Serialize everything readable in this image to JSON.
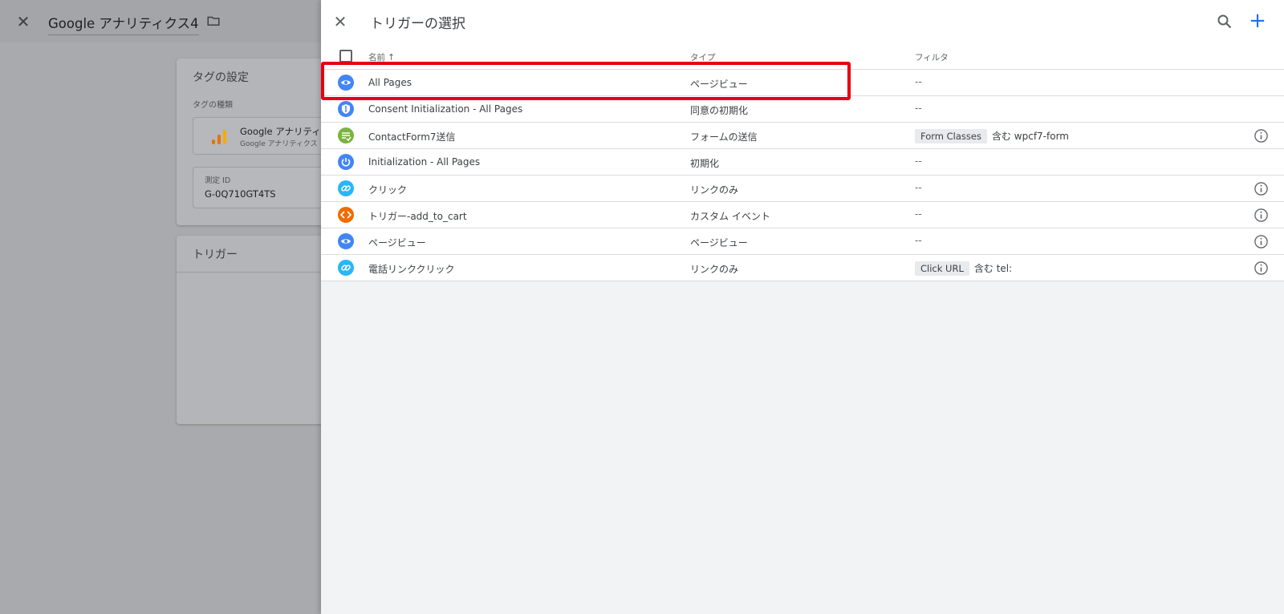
{
  "editor": {
    "title": "Google アナリティクス4",
    "tag_card": {
      "heading": "タグの設定",
      "type_label": "タグの種類",
      "type_name": "Google アナリティ",
      "type_sub": "Google アナリティクス",
      "id_label": "測定 ID",
      "id_value": "G-0Q710GT4TS"
    },
    "trigger_card": {
      "heading": "トリガー"
    }
  },
  "panel": {
    "title": "トリガーの選択",
    "columns": {
      "name": "名前",
      "name_sort": "↑",
      "type": "タイプ",
      "filter": "フィルタ"
    },
    "rows": [
      {
        "name": "All Pages",
        "type": "ページビュー",
        "filter_text": "--",
        "icon": "eye-icon",
        "color": "#4285f4",
        "info": false
      },
      {
        "name": "Consent Initialization - All Pages",
        "type": "同意の初期化",
        "filter_text": "--",
        "icon": "shield-icon",
        "color": "#4285f4",
        "info": false
      },
      {
        "name": "ContactForm7送信",
        "type": "フォームの送信",
        "chip": "Form Classes",
        "op": "含む",
        "value": "wpcf7-form",
        "icon": "form-icon",
        "color": "#7cb342",
        "info": true
      },
      {
        "name": "Initialization - All Pages",
        "type": "初期化",
        "filter_text": "--",
        "icon": "power-icon",
        "color": "#4285f4",
        "info": false
      },
      {
        "name": "クリック",
        "type": "リンクのみ",
        "filter_text": "--",
        "icon": "link-icon",
        "color": "#29b6f6",
        "info": true
      },
      {
        "name": "トリガー-add_to_cart",
        "type": "カスタム イベント",
        "filter_text": "--",
        "icon": "code-icon",
        "color": "#ef6c00",
        "info": true
      },
      {
        "name": "ページビュー",
        "type": "ページビュー",
        "filter_text": "--",
        "icon": "eye-icon",
        "color": "#4285f4",
        "info": true
      },
      {
        "name": "電話リンククリック",
        "type": "リンクのみ",
        "chip": "Click URL",
        "op": "含む",
        "value": "tel:",
        "icon": "link-icon",
        "color": "#29b6f6",
        "info": true
      }
    ]
  },
  "colors": {
    "accent": "#1a73e8",
    "highlight": "#e60012"
  }
}
